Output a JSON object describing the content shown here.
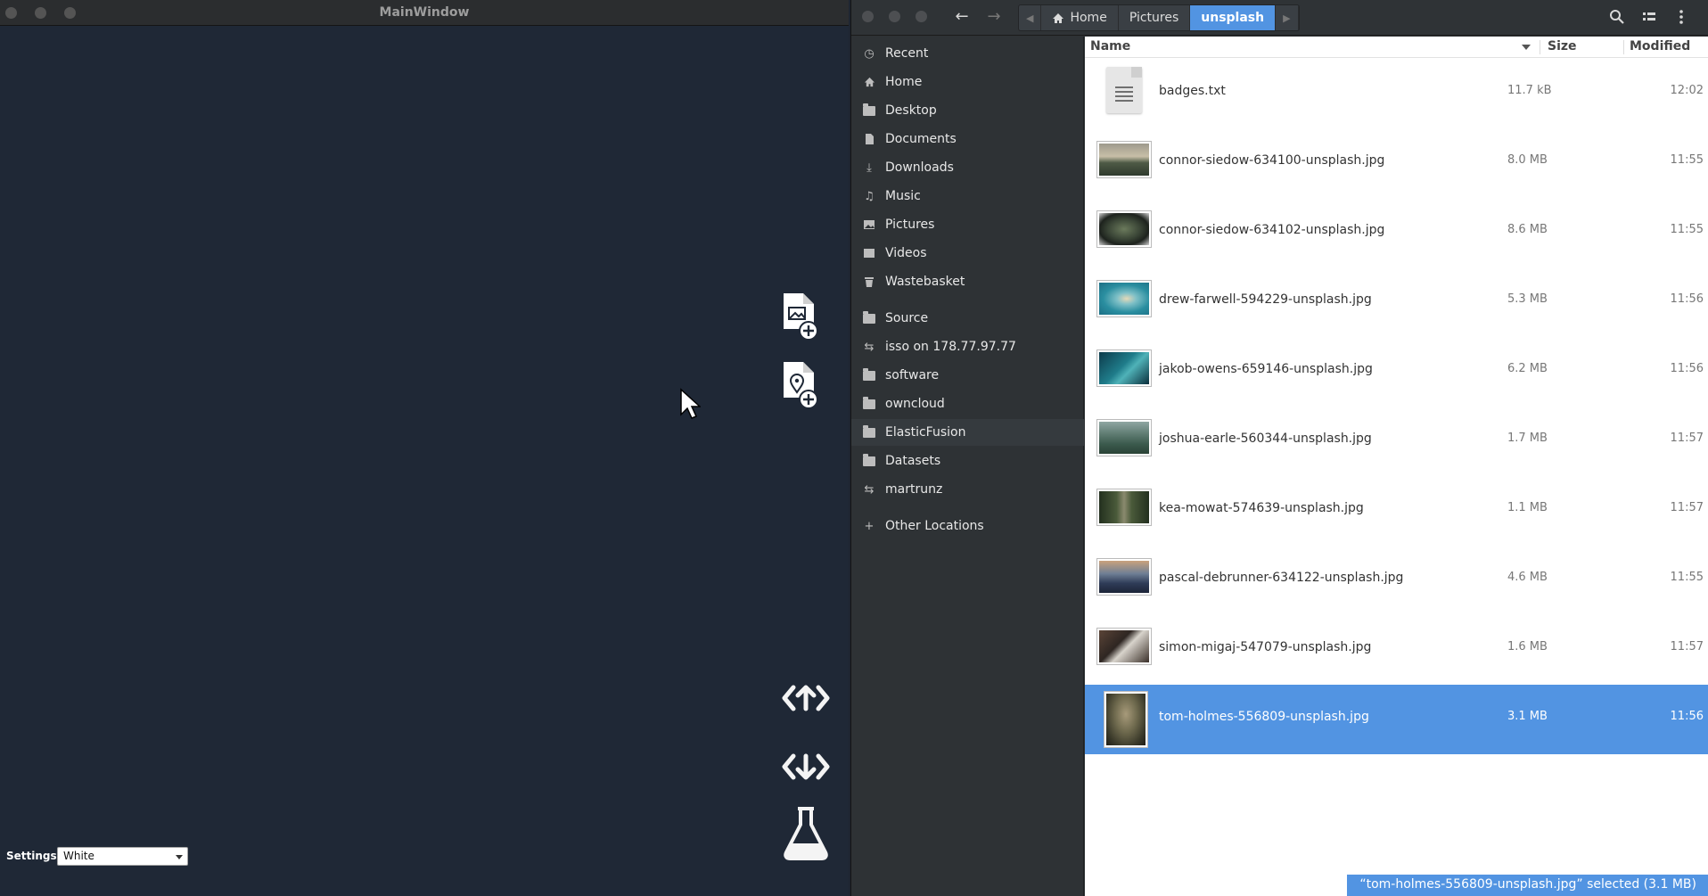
{
  "main_window": {
    "title": "MainWindow",
    "settings_label": "Settings:",
    "settings_value": "White",
    "tools": [
      "add-image-file-icon",
      "add-location-file-icon",
      "upload-code-icon",
      "download-code-icon",
      "flask-icon"
    ]
  },
  "file_chooser": {
    "breadcrumb": [
      "Home",
      "Pictures",
      "unsplash"
    ],
    "places": [
      {
        "label": "Recent",
        "icon": "clock-icon"
      },
      {
        "label": "Home",
        "icon": "home-icon"
      },
      {
        "label": "Desktop",
        "icon": "desktop-icon"
      },
      {
        "label": "Documents",
        "icon": "document-icon"
      },
      {
        "label": "Downloads",
        "icon": "download-icon"
      },
      {
        "label": "Music",
        "icon": "music-icon"
      },
      {
        "label": "Pictures",
        "icon": "pictures-icon"
      },
      {
        "label": "Videos",
        "icon": "videos-icon"
      },
      {
        "label": "Wastebasket",
        "icon": "trash-icon"
      },
      {
        "label": "Source",
        "icon": "folder-icon"
      },
      {
        "label": "isso on 178.77.97.77",
        "icon": "network-icon"
      },
      {
        "label": "software",
        "icon": "folder-icon"
      },
      {
        "label": "owncloud",
        "icon": "folder-icon"
      },
      {
        "label": "ElasticFusion",
        "icon": "folder-icon"
      },
      {
        "label": "Datasets",
        "icon": "folder-icon"
      },
      {
        "label": "martrunz",
        "icon": "network-icon"
      },
      {
        "label": "Other Locations",
        "icon": "plus-icon"
      }
    ],
    "columns": {
      "name": "Name",
      "size": "Size",
      "modified": "Modified"
    },
    "files": [
      {
        "name": "badges.txt",
        "size": "11.7 kB",
        "modified": "12:02"
      },
      {
        "name": "connor-siedow-634100-unsplash.jpg",
        "size": "8.0 MB",
        "modified": "11:55"
      },
      {
        "name": "connor-siedow-634102-unsplash.jpg",
        "size": "8.6 MB",
        "modified": "11:55"
      },
      {
        "name": "drew-farwell-594229-unsplash.jpg",
        "size": "5.3 MB",
        "modified": "11:56"
      },
      {
        "name": "jakob-owens-659146-unsplash.jpg",
        "size": "6.2 MB",
        "modified": "11:56"
      },
      {
        "name": "joshua-earle-560344-unsplash.jpg",
        "size": "1.7 MB",
        "modified": "11:57"
      },
      {
        "name": "kea-mowat-574639-unsplash.jpg",
        "size": "1.1 MB",
        "modified": "11:57"
      },
      {
        "name": "pascal-debrunner-634122-unsplash.jpg",
        "size": "4.6 MB",
        "modified": "11:55"
      },
      {
        "name": "simon-migaj-547079-unsplash.jpg",
        "size": "1.6 MB",
        "modified": "11:57"
      },
      {
        "name": "tom-holmes-556809-unsplash.jpg",
        "size": "3.1 MB",
        "modified": "11:56"
      }
    ],
    "status": "“tom-holmes-556809-unsplash.jpg” selected  (3.1 MB)",
    "colors": {
      "selection": "#5294e2",
      "sidebar": "#2e3235",
      "main_bg": "#1f2836"
    }
  }
}
